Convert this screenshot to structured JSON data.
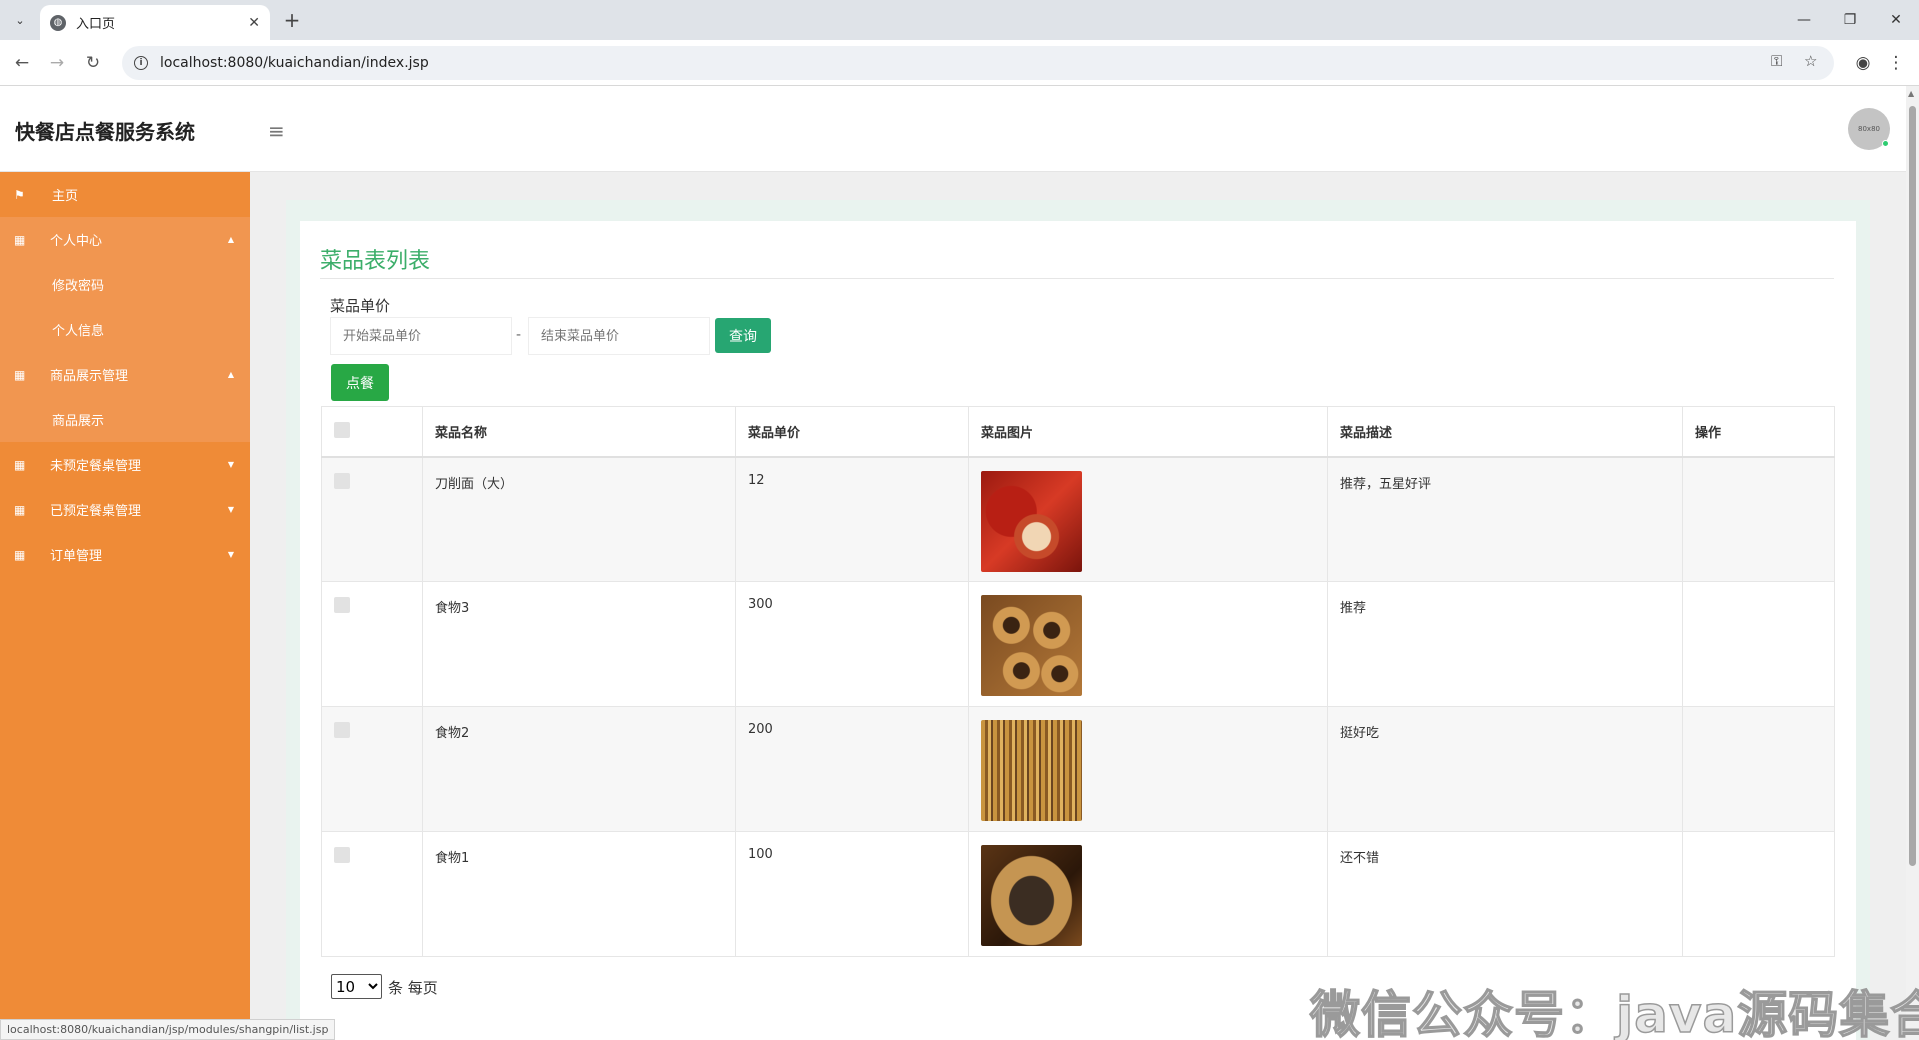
{
  "browser": {
    "tab_title": "入口页",
    "tab_icon": "globe-icon",
    "url": "localhost:8080/kuaichandian/index.jsp",
    "status_url": "localhost:8080/kuaichandian/jsp/modules/shangpin/list.jsp"
  },
  "app": {
    "title": "快餐店点餐服务系统",
    "avatar_text": "80x80"
  },
  "sidebar": {
    "items": [
      {
        "label": "主页",
        "icon": "flag-icon",
        "type": "top"
      },
      {
        "label": "个人中心",
        "icon": "grid-icon",
        "type": "parent",
        "caret": "up"
      },
      {
        "label": "修改密码",
        "type": "sub"
      },
      {
        "label": "个人信息",
        "type": "sub"
      },
      {
        "label": "商品展示管理",
        "icon": "grid-icon",
        "type": "parent",
        "caret": "up"
      },
      {
        "label": "商品展示",
        "type": "sub"
      },
      {
        "label": "未预定餐桌管理",
        "icon": "grid-icon",
        "type": "top",
        "caret": "down"
      },
      {
        "label": "已预定餐桌管理",
        "icon": "grid-icon",
        "type": "top",
        "caret": "down"
      },
      {
        "label": "订单管理",
        "icon": "grid-icon",
        "type": "top",
        "caret": "down"
      }
    ]
  },
  "main": {
    "title": "菜品表列表",
    "filter_label": "菜品单价",
    "start_placeholder": "开始菜品单价",
    "end_placeholder": "结束菜品单价",
    "range_sep": "-",
    "search_button": "查询",
    "order_button": "点餐",
    "table": {
      "headers": [
        "菜品名称",
        "菜品单价",
        "菜品图片",
        "菜品描述",
        "操作"
      ],
      "rows": [
        {
          "name": "刀削面（大）",
          "price": "12",
          "desc": "推荐，五星好评"
        },
        {
          "name": "食物3",
          "price": "300",
          "desc": "推荐"
        },
        {
          "name": "食物2",
          "price": "200",
          "desc": "挺好吃"
        },
        {
          "name": "食物1",
          "price": "100",
          "desc": "还不错"
        }
      ]
    },
    "page_size": "10",
    "page_size_label": "条 每页"
  },
  "watermark": "微信公众号：java源码集合",
  "colors": {
    "sidebar": "#ef8b37",
    "accent_green": "#3cae6a",
    "button_green": "#28a845"
  }
}
